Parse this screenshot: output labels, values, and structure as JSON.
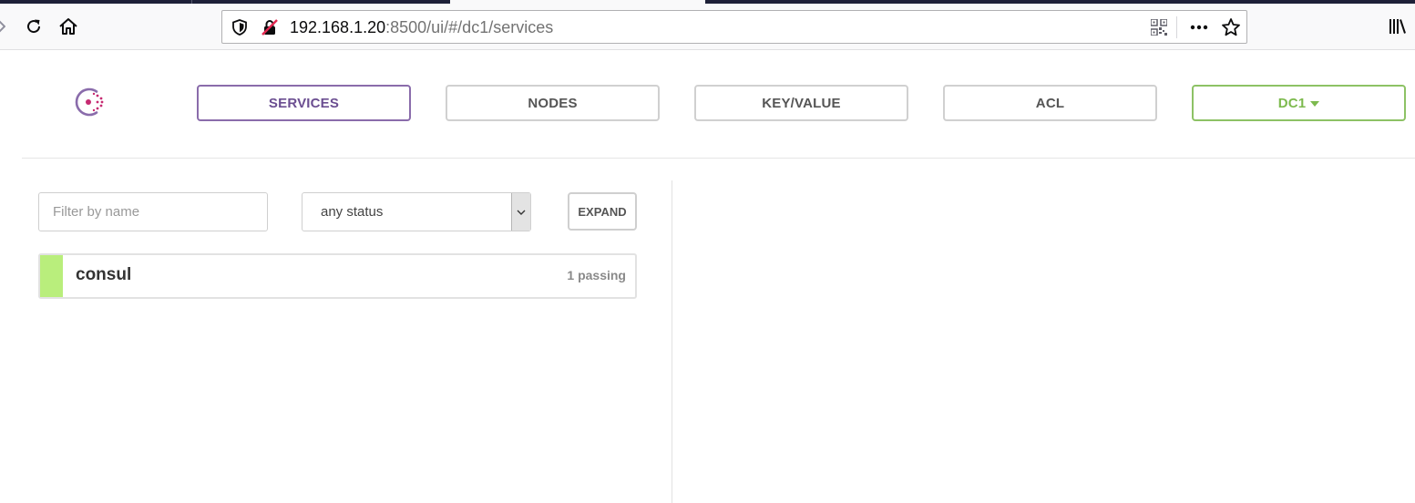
{
  "browser": {
    "url_host": "192.168.1.20",
    "url_path": ":8500/ui/#/dc1/services",
    "icons": [
      "back-icon",
      "reload-icon",
      "home-icon",
      "shield-icon",
      "insecure-connection-icon",
      "qr-code-icon",
      "more-icon",
      "bookmark-star-icon",
      "library-icon"
    ]
  },
  "nav": {
    "services": "SERVICES",
    "nodes": "NODES",
    "keyvalue": "KEY/VALUE",
    "acl": "ACL",
    "datacenter": "DC1"
  },
  "filters": {
    "name_placeholder": "Filter by name",
    "name_value": "",
    "status_value": "any status",
    "expand_label": "EXPAND"
  },
  "services": [
    {
      "name": "consul",
      "status_text": "1 passing",
      "health_color": "#b9ee7c"
    }
  ],
  "colors": {
    "brand": "#8a6cab",
    "brand_pink": "#c62a71",
    "datacenter_green": "#7dba4e",
    "passing_green": "#b9ee7c"
  }
}
